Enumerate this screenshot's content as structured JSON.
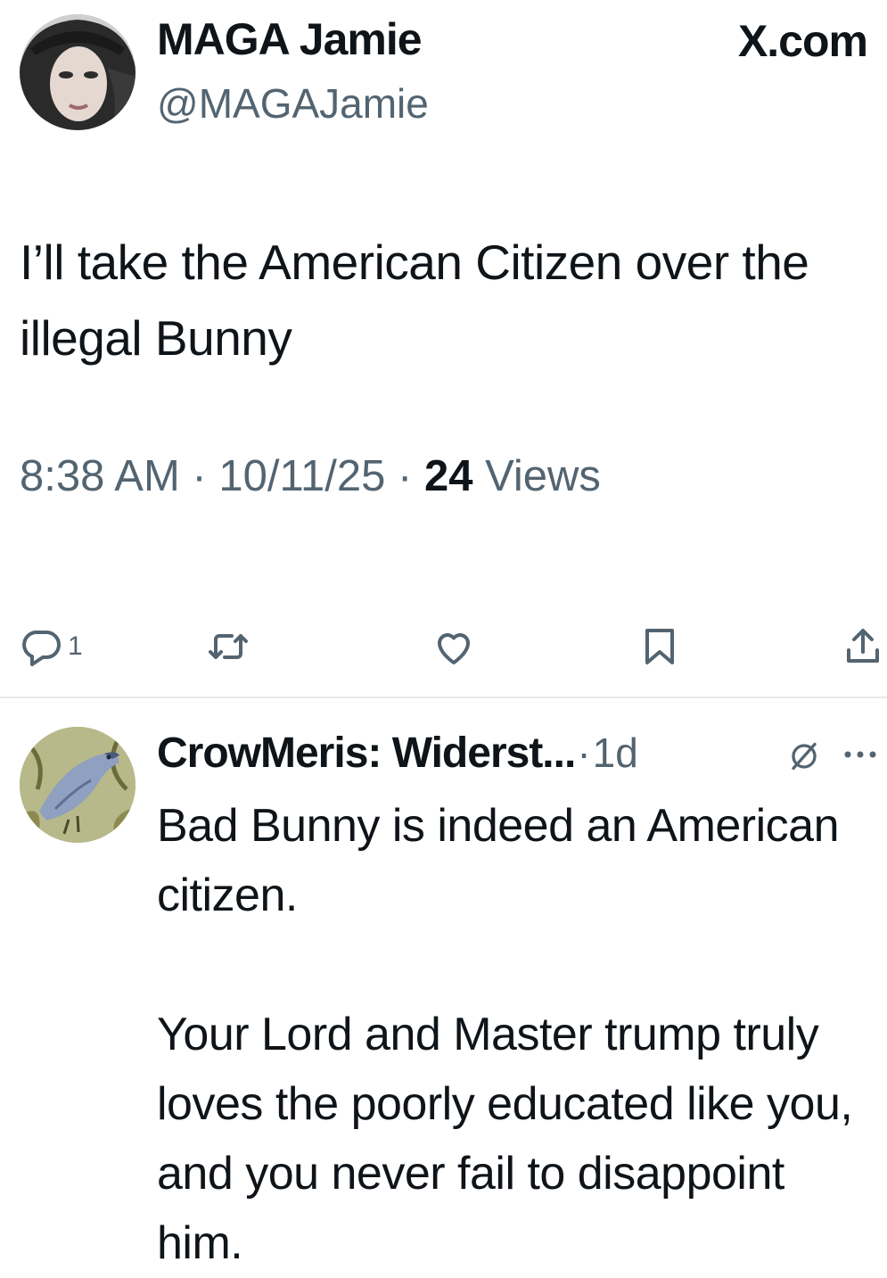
{
  "tweet": {
    "author": {
      "display_name": "MAGA Jamie",
      "handle": "@MAGAJamie",
      "avatar_icon": "profile-photo-icon"
    },
    "site_label": "X.com",
    "text": "I’ll take the American Citizen over the illegal Bunny",
    "time": "8:38 AM",
    "separator": " · ",
    "date": "10/11/25",
    "views_count": "24",
    "views_label": " Views",
    "actions": {
      "reply_count": "1",
      "reply_icon": "reply-bubble-icon",
      "repost_icon": "repost-icon",
      "like_icon": "heart-icon",
      "bookmark_icon": "bookmark-icon",
      "share_icon": "share-icon"
    }
  },
  "reply": {
    "author": {
      "display_name": "CrowMeris: Widerst...",
      "avatar_icon": "crow-artwork-icon"
    },
    "time_prefix": " · ",
    "time": "1d",
    "paragraphs": [
      "Bad Bunny is indeed an American citizen.",
      "Your Lord and Master trump truly loves the poorly educated like you, and you never fail to disappoint him."
    ]
  },
  "colors": {
    "text_primary": "#0f1419",
    "text_secondary": "#536471",
    "divider": "#e6e9eb",
    "background": "#ffffff"
  }
}
